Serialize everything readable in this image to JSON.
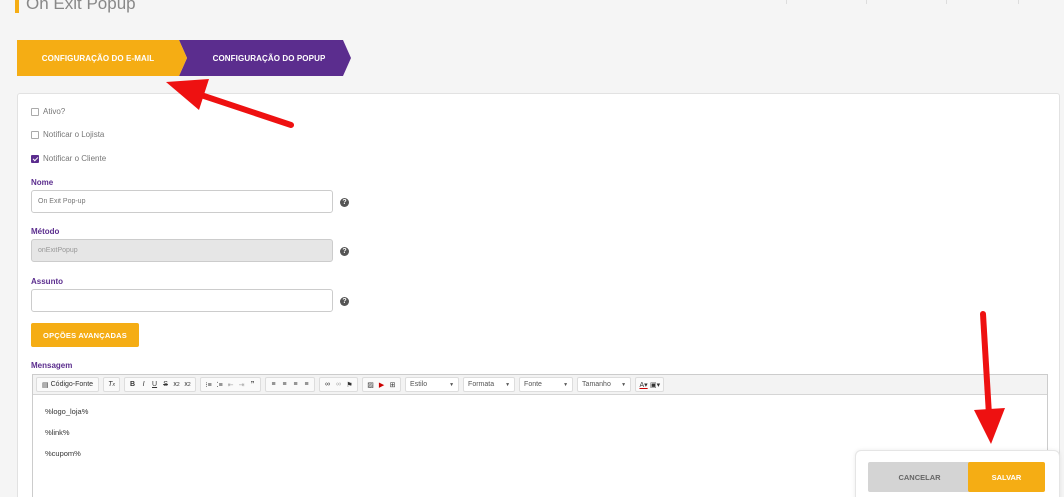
{
  "page": {
    "title": "On Exit Popup"
  },
  "steps": [
    {
      "label": "CONFIGURAÇÃO DO E-MAIL",
      "active": true
    },
    {
      "label": "CONFIGURAÇÃO DO POPUP",
      "active": false
    }
  ],
  "form": {
    "ativo": {
      "label": "Ativo?",
      "checked": false
    },
    "notificar_lojista": {
      "label": "Notificar o Lojista",
      "checked": false
    },
    "notificar_cliente": {
      "label": "Notificar o Cliente",
      "checked": true
    },
    "nome": {
      "label": "Nome",
      "value": "On Exit Pop-up"
    },
    "metodo": {
      "label": "Método",
      "value": "onExitPopup"
    },
    "assunto": {
      "label": "Assunto",
      "value": ""
    },
    "advanced_button": "OPÇÕES AVANÇADAS",
    "mensagem": {
      "label": "Mensagem"
    }
  },
  "editor": {
    "source_label": "Código-Fonte",
    "combos": {
      "style": "Estilo",
      "format": "Formata",
      "font": "Fonte",
      "size": "Tamanho"
    },
    "content": [
      "%logo_loja%",
      "%link%",
      "%cupom%"
    ]
  },
  "footer": {
    "cancel_label": "CANCELAR",
    "save_label": "SALVAR"
  },
  "colors": {
    "accent": "#f5ad14",
    "brand": "#5b2d8e",
    "annotation": "#ee1111"
  },
  "icons": {
    "help": "question-circle-icon"
  }
}
